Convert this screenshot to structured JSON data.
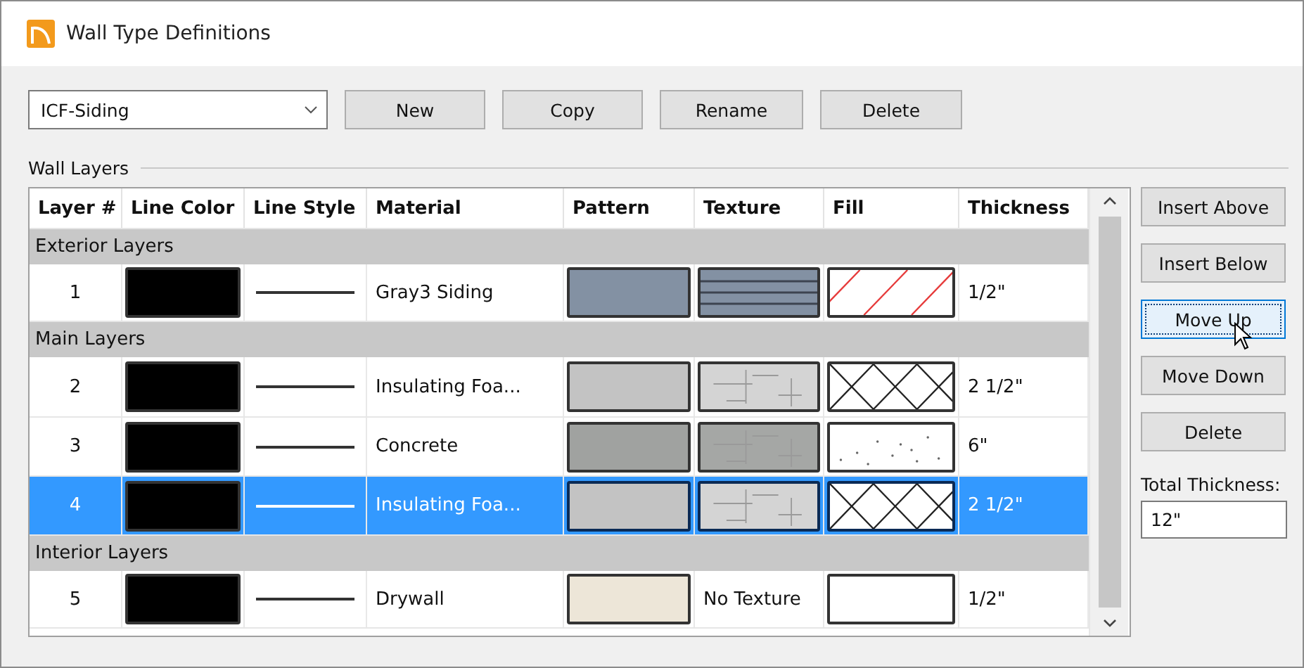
{
  "window": {
    "title": "Wall Type Definitions"
  },
  "wall_type": {
    "value": "ICF-Siding"
  },
  "top_buttons": [
    "New",
    "Copy",
    "Rename",
    "Delete"
  ],
  "group_label": "Wall Layers",
  "table": {
    "columns": [
      "Layer #",
      "Line Color",
      "Line Style",
      "Material",
      "Pattern",
      "Texture",
      "Fill",
      "Thickness"
    ],
    "rows": [
      {
        "kind": "group",
        "label": "Exterior Layers"
      },
      {
        "kind": "layer",
        "number": "1",
        "line": {
          "color": "#000000"
        },
        "material": "Gray3 Siding",
        "pattern": {
          "color": "#8391a3"
        },
        "texture": {
          "kind": "siding",
          "color": "#8391a3"
        },
        "fill": {
          "kind": "diagonal"
        },
        "thickness": "1/2\"",
        "selected": false
      },
      {
        "kind": "group",
        "label": "Main Layers"
      },
      {
        "kind": "layer",
        "number": "2",
        "line": {
          "color": "#000000"
        },
        "material": "Insulating Foa...",
        "pattern": {
          "color": "#c3c3c3"
        },
        "texture": {
          "kind": "stone",
          "color": "#d4d4d4"
        },
        "fill": {
          "kind": "crosshatch"
        },
        "thickness": "2 1/2\"",
        "selected": false
      },
      {
        "kind": "layer",
        "number": "3",
        "line": {
          "color": "#000000"
        },
        "material": "Concrete",
        "pattern": {
          "color": "#a0a2a0"
        },
        "texture": {
          "kind": "stone",
          "color": "#a5a7a5"
        },
        "fill": {
          "kind": "speckle"
        },
        "thickness": "6\"",
        "selected": false
      },
      {
        "kind": "layer",
        "number": "4",
        "line": {
          "color": "#000000"
        },
        "material": "Insulating Foa...",
        "pattern": {
          "color": "#c3c3c3"
        },
        "texture": {
          "kind": "stone",
          "color": "#d4d4d4"
        },
        "fill": {
          "kind": "crosshatch"
        },
        "thickness": "2 1/2\"",
        "selected": true
      },
      {
        "kind": "group",
        "label": "Interior Layers"
      },
      {
        "kind": "layer",
        "number": "5",
        "line": {
          "color": "#000000"
        },
        "material": "Drywall",
        "pattern": {
          "color": "#ede6d8"
        },
        "texture": {
          "kind": "none",
          "label": "No Texture"
        },
        "fill": {
          "kind": "solid"
        },
        "thickness": "1/2\"",
        "selected": false
      }
    ]
  },
  "side_buttons": [
    {
      "label": "Insert Above",
      "focused": false
    },
    {
      "label": "Insert Below",
      "focused": false
    },
    {
      "label": "Move Up",
      "focused": true
    },
    {
      "label": "Move Down",
      "focused": false
    },
    {
      "label": "Delete",
      "focused": false
    }
  ],
  "total_thickness": {
    "label": "Total Thickness:",
    "value": "12\""
  }
}
